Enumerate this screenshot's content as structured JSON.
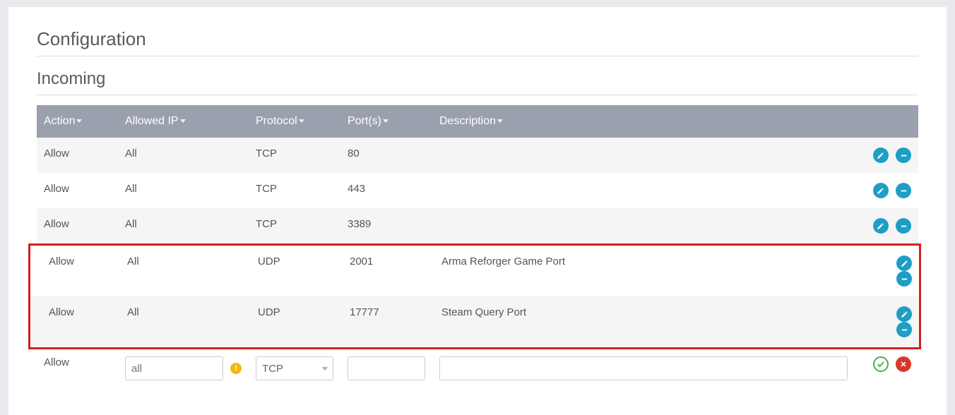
{
  "titles": {
    "configuration": "Configuration",
    "incoming": "Incoming"
  },
  "headers": {
    "action": "Action",
    "ip": "Allowed IP",
    "protocol": "Protocol",
    "ports": "Port(s)",
    "description": "Description"
  },
  "rows": [
    {
      "action": "Allow",
      "ip": "All",
      "protocol": "TCP",
      "ports": "80",
      "description": ""
    },
    {
      "action": "Allow",
      "ip": "All",
      "protocol": "TCP",
      "ports": "443",
      "description": ""
    },
    {
      "action": "Allow",
      "ip": "All",
      "protocol": "TCP",
      "ports": "3389",
      "description": ""
    },
    {
      "action": "Allow",
      "ip": "All",
      "protocol": "UDP",
      "ports": "2001",
      "description": "Arma Reforger Game Port"
    },
    {
      "action": "Allow",
      "ip": "All",
      "protocol": "UDP",
      "ports": "17777",
      "description": "Steam Query Port"
    }
  ],
  "form": {
    "action": "Allow",
    "ip_placeholder": "all",
    "protocol": "TCP",
    "ports": "",
    "description": ""
  }
}
